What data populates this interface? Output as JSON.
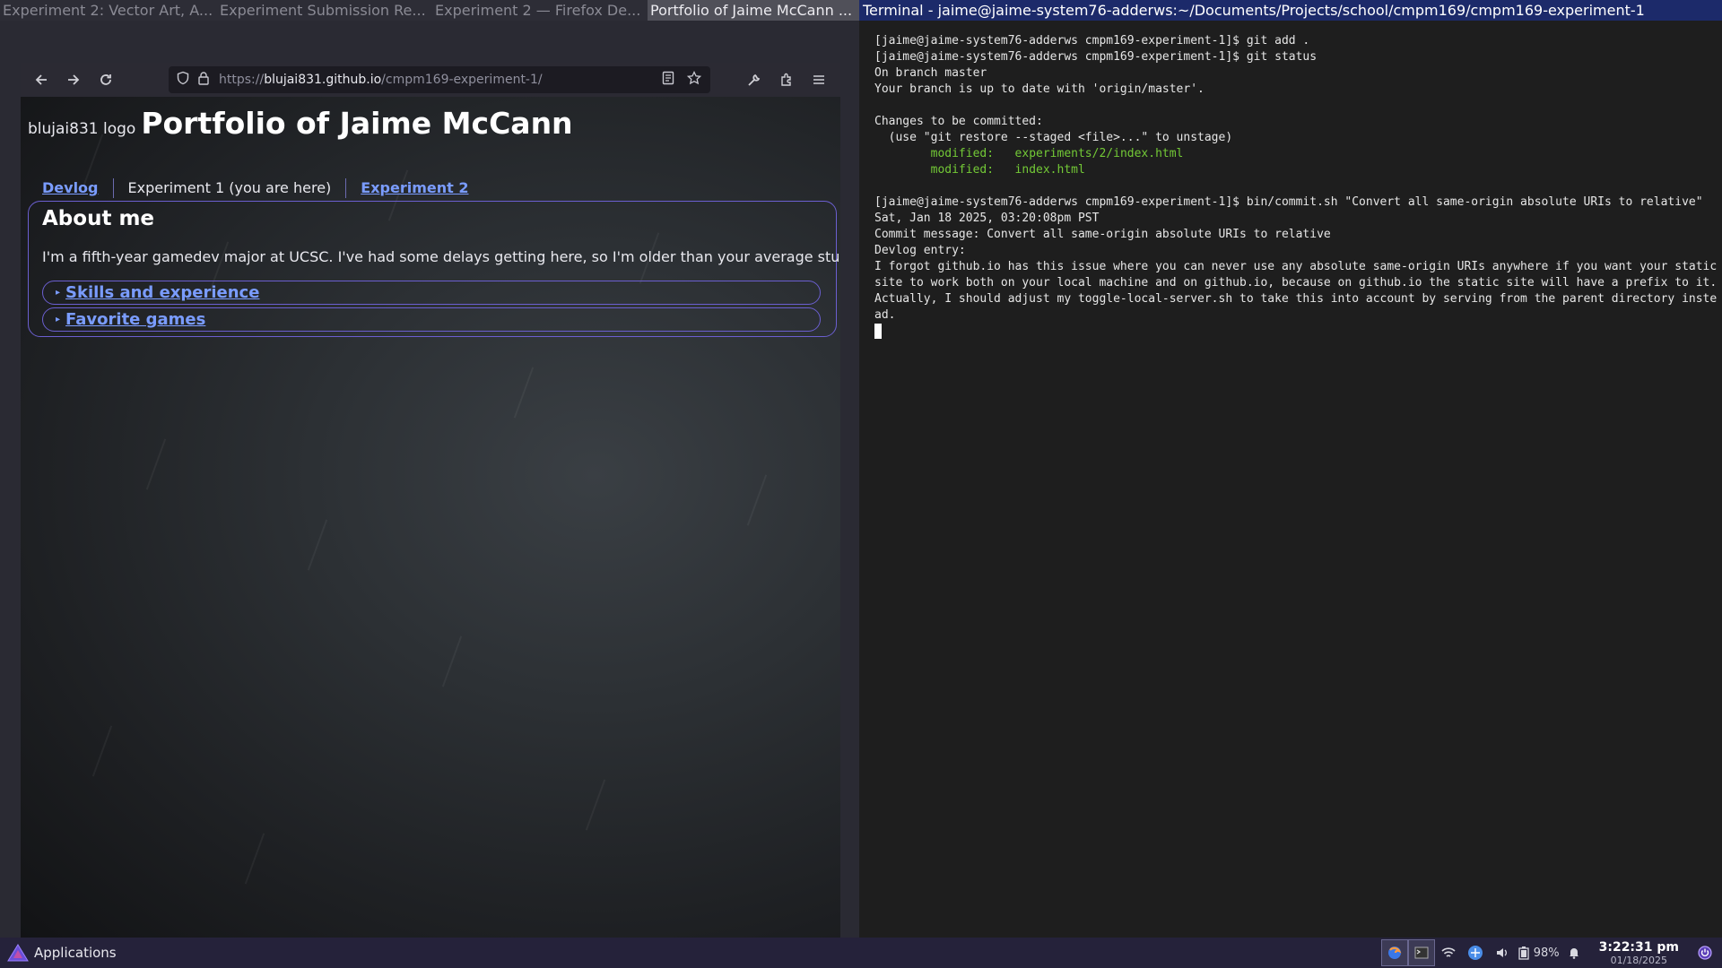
{
  "window_tabs": [
    {
      "title": "Experiment 2: Vector Art, A..."
    },
    {
      "title": "Experiment Submission Re..."
    },
    {
      "title": "Experiment 2 — Firefox De..."
    },
    {
      "title": "Portfolio of Jaime McCann ..."
    },
    {
      "title": "Terminal - jaime@jaime-system76-adderws:~/Documents/Projects/school/cmpm169/cmpm169-experiment-1"
    }
  ],
  "browser": {
    "url_prefix": "https://",
    "url_host": "blujai831.github.io",
    "url_path": "/cmpm169-experiment-1/",
    "toolbar_icons": [
      "back-icon",
      "forward-icon",
      "reload-icon",
      "shield-icon",
      "lock-icon",
      "reader-icon",
      "bookmark-star-icon",
      "wrench-icon",
      "extensions-icon",
      "menu-icon"
    ]
  },
  "page": {
    "logo_alt": "blujai831 logo",
    "title": "Portfolio of Jaime McCann",
    "nav": {
      "devlog": "Devlog",
      "current": "Experiment 1 (you are here)",
      "experiment2": "Experiment 2"
    },
    "about": {
      "heading": "About me",
      "text": "I'm a fifth-year gamedev major at UCSC. I've had some delays getting here, so I'm older than your average student.",
      "details": [
        {
          "summary": "Skills and experience"
        },
        {
          "summary": "Favorite games"
        }
      ]
    }
  },
  "terminal": {
    "lines": [
      "[jaime@jaime-system76-adderws cmpm169-experiment-1]$ git add .",
      "[jaime@jaime-system76-adderws cmpm169-experiment-1]$ git status",
      "On branch master",
      "Your branch is up to date with 'origin/master'.",
      "",
      "Changes to be committed:",
      "  (use \"git restore --staged <file>...\" to unstage)",
      "        modified:   experiments/2/index.html",
      "        modified:   index.html",
      "",
      "[jaime@jaime-system76-adderws cmpm169-experiment-1]$ bin/commit.sh \"Convert all same-origin absolute URIs to relative\"",
      "Sat, Jan 18 2025, 03:20:08pm PST",
      "Commit message: Convert all same-origin absolute URIs to relative",
      "Devlog entry:",
      "I forgot github.io has this issue where you can never use any absolute same-origin URIs anywhere if you want your static site to work both on your local machine and on github.io, because on github.io the static site will have a prefix to it. Actually, I should adjust my toggle-local-server.sh to take this into account by serving from the parent directory instead."
    ],
    "green_line_indexes": [
      7,
      8
    ]
  },
  "panel": {
    "applications_label": "Applications",
    "battery_percent": "98%",
    "clock_time": "3:22:31 pm",
    "clock_date": "01/18/2025",
    "tray_icons": [
      "firefox-icon",
      "terminal-icon",
      "wifi-icon",
      "network-icon",
      "volume-icon",
      "battery-icon",
      "notification-bell-icon",
      "power-icon"
    ]
  },
  "colors": {
    "terminal_title_bg": "#1c2a6a",
    "link": "#7a9cff",
    "box_border": "#6b5fd0",
    "terminal_green": "#73c936",
    "panel_bg": "#25223a"
  }
}
